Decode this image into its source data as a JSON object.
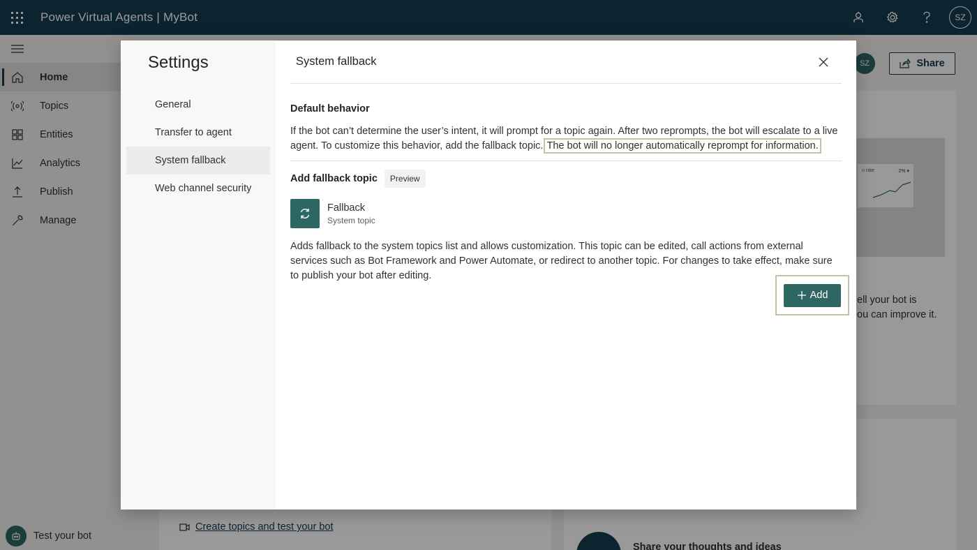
{
  "topbar": {
    "app_title": "Power Virtual Agents | MyBot",
    "avatar_initials": "SZ"
  },
  "nav": {
    "items": [
      {
        "label": "Home",
        "icon": "home-icon"
      },
      {
        "label": "Topics",
        "icon": "topics-icon"
      },
      {
        "label": "Entities",
        "icon": "entities-icon"
      },
      {
        "label": "Analytics",
        "icon": "analytics-icon"
      },
      {
        "label": "Publish",
        "icon": "publish-icon"
      },
      {
        "label": "Manage",
        "icon": "manage-icon"
      }
    ],
    "test_bot_label": "Test your bot"
  },
  "background": {
    "share_label": "Share",
    "avatar_initials": "SZ",
    "card_text_line1": "ell your bot is",
    "card_text_line2": "ou can improve it.",
    "illus_label": "n rate",
    "illus_value": "2% ▾",
    "link_label": "Create topics and test your bot",
    "share_thoughts": "Share your thoughts and ideas"
  },
  "dialog": {
    "title": "Settings",
    "side_items": [
      "General",
      "Transfer to agent",
      "System fallback",
      "Web channel security"
    ],
    "active_item": "System fallback",
    "header": "System fallback",
    "default_behavior": {
      "title": "Default behavior",
      "text": "If the bot can’t determine the user’s intent, it will prompt for a topic again. After two reprompts, the bot will escalate to a live agent. To customize this behavior, add the fallback topic.",
      "highlight": "The bot will no longer automatically reprompt for information."
    },
    "add_fallback": {
      "title": "Add fallback topic",
      "badge": "Preview",
      "topic_name": "Fallback",
      "topic_sub": "System topic",
      "description": "Adds fallback to the system topics list and allows customization. This topic can be edited, call actions from external services such as Bot Framework and Power Automate, or redirect to another topic. For changes to take effect, make sure to publish your bot after editing.",
      "add_label": "Add"
    }
  },
  "colors": {
    "topbar": "#133d4f",
    "accent": "#2e6663"
  }
}
